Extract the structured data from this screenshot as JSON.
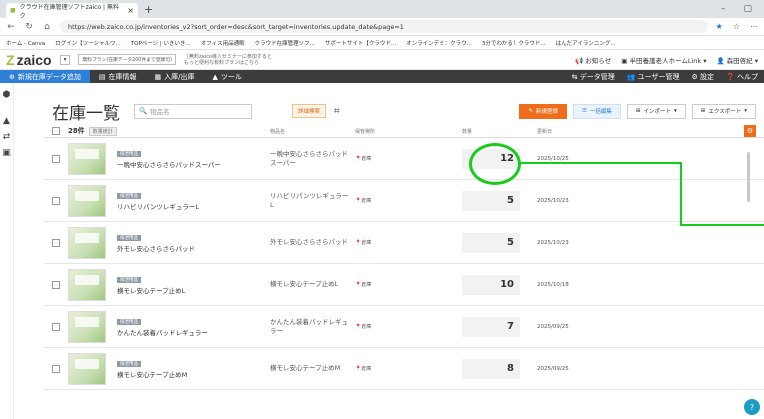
{
  "browser": {
    "tab_title": "クラウド在庫管理ソフトzaico | 無料ク",
    "url": "https://web.zaico.co.jp/inventories_v2?sort_order=desc&sort_target=inventories.update_date&page=1",
    "bookmarks": [
      "ホーム - Canva",
      "ログイン【ツーシャルワ...",
      "TOPページ | いきいき...",
      "オフィス用品通販",
      "クラウド在庫管理ソフ...",
      "サポートサイト【クラウド...",
      "オンラインデミ：クラウ...",
      "3分でわかる！クラウド...",
      "はんだアイランニング..."
    ]
  },
  "app": {
    "logo": "zaico",
    "account_select": "無料プラン(在庫データ200件まで登録可)",
    "promo_line1": "［無料zaico導入セミナーに参加すると",
    "promo_line2": "もっと便利な有料プランはこちら",
    "header_links": {
      "notice": "お知らせ",
      "org": "半田養護老人ホームLink",
      "user": "森田啓紀"
    }
  },
  "nav": {
    "add": "新規在庫データ追加",
    "info": "在庫情報",
    "inout": "入庫/出庫",
    "tools": "ツール",
    "data_mgmt": "データ管理",
    "user_mgmt": "ユーザー管理",
    "settings": "設定",
    "help": "ヘルプ"
  },
  "toolbar": {
    "title": "在庫一覧",
    "search_placeholder": "物品名",
    "advanced": "詳細検索",
    "new_btn": "新規登録",
    "bulk_edit": "一括編集",
    "import": "インポート",
    "export": "エクスポート"
  },
  "table": {
    "count": "28件",
    "count_badge": "数量統計",
    "col_name": "物品名",
    "col_location": "保管場所",
    "col_qty": "数量",
    "col_date": "更新日",
    "rows": [
      {
        "tag": "排泄用品",
        "name": "一晩中安心さらさらパッドスーパー",
        "desc": "一晩中安心さらさらパッドスーパー",
        "location": "倉庫",
        "qty": "12",
        "date": "2025/10/25"
      },
      {
        "tag": "排泄用品",
        "name": "リハビリパンツレギュラーL",
        "desc": "リハビリパンツレギュラーL",
        "location": "倉庫",
        "qty": "5",
        "date": "2025/10/23"
      },
      {
        "tag": "排泄用品",
        "name": "外モレ安心さらさらパッド",
        "desc": "外モレ安心さらさらパッド",
        "location": "倉庫",
        "qty": "5",
        "date": "2025/10/23"
      },
      {
        "tag": "排泄用品",
        "name": "横モレ安心テープ止めL",
        "desc": "横モレ安心テープ止めL",
        "location": "倉庫",
        "qty": "10",
        "date": "2025/10/18"
      },
      {
        "tag": "排泄用品",
        "name": "かんたん装着パッドレギュラー",
        "desc": "かんたん装着パッドレギュラー",
        "location": "倉庫",
        "qty": "7",
        "date": "2025/09/25"
      },
      {
        "tag": "排泄用品",
        "name": "横モレ安心テープ止めM",
        "desc": "横モレ安心テープ止めM",
        "location": "倉庫",
        "qty": "8",
        "date": "2025/09/25"
      }
    ]
  },
  "colors": {
    "accent_orange": "#ef6c1a",
    "nav_active": "#2f7fd6",
    "highlight": "#18cc1a"
  }
}
